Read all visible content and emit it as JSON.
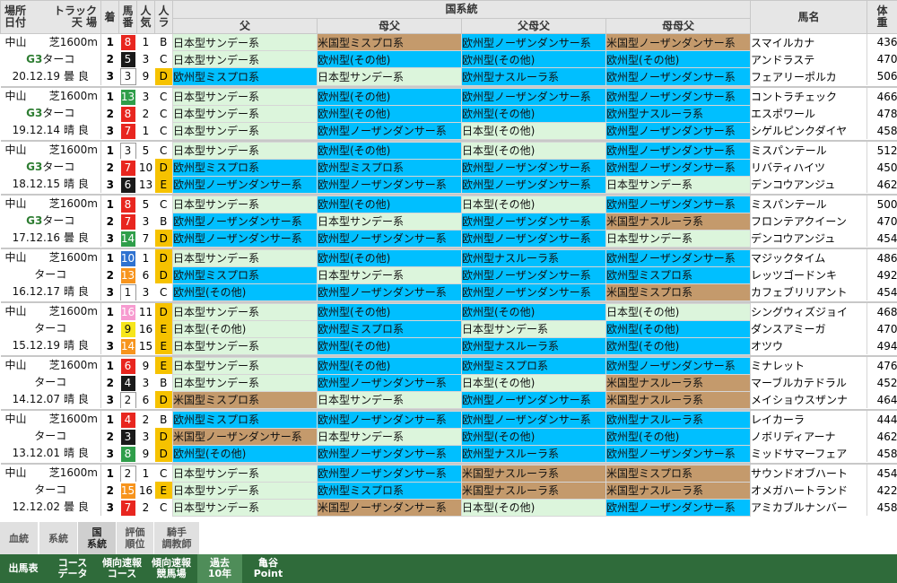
{
  "colors": {
    "jp": "#dcf5dc",
    "eu": "#00bfff",
    "us": "#c49a6c",
    "gate": [
      "#ffffff",
      "#1a1a1a",
      "#e8261f",
      "#2f72d0",
      "#f6e61b",
      "#2f9e4a",
      "#f7941d",
      "#f79bd0"
    ],
    "style": {
      "B": "#ffffff",
      "C": "#ffffff",
      "D": "#f6c200",
      "E": "#f6c200"
    }
  },
  "header": {
    "place": "場所",
    "date": "日付",
    "track": "トラック",
    "track2": "天 場",
    "finish": "着",
    "num": "馬番",
    "pop": "人気",
    "style": "人ラ",
    "country_lineage": "国系統",
    "sire": "父",
    "damsire": "母父",
    "sire_dam": "父母父",
    "dam_dam_sire": "母母父",
    "horse": "馬名",
    "weight": "体重"
  },
  "races": [
    {
      "venue": "中山",
      "course": "芝1600m",
      "grade": "G3",
      "cond": "ターコ",
      "date": "20.12.19",
      "weather": "曇 良",
      "rows": [
        {
          "fin": "1",
          "gate": "3",
          "num": "8",
          "pop": "1",
          "style": "B",
          "lin": [
            [
              "jp",
              "日本型サンデー系"
            ],
            [
              "us",
              "米国型ミスプロ系"
            ],
            [
              "eu",
              "欧州型ノーザンダンサー系"
            ],
            [
              "us",
              "米国型ノーザンダンサー系"
            ]
          ],
          "horse": "スマイルカナ",
          "wt": "436"
        },
        {
          "fin": "2",
          "gate": "2",
          "num": "5",
          "pop": "3",
          "style": "C",
          "lin": [
            [
              "jp",
              "日本型サンデー系"
            ],
            [
              "eu",
              "欧州型(その他)"
            ],
            [
              "eu",
              "欧州型(その他)"
            ],
            [
              "eu",
              "欧州型(その他)"
            ]
          ],
          "horse": "アンドラステ",
          "wt": "470"
        },
        {
          "fin": "3",
          "gate": "1",
          "num": "3",
          "pop": "9",
          "style": "D",
          "lin": [
            [
              "eu",
              "欧州型ミスプロ系"
            ],
            [
              "jp",
              "日本型サンデー系"
            ],
            [
              "eu",
              "欧州型ナスルーラ系"
            ],
            [
              "eu",
              "欧州型ノーザンダンサー系"
            ]
          ],
          "horse": "フェアリーポルカ",
          "wt": "506"
        }
      ]
    },
    {
      "venue": "中山",
      "course": "芝1600m",
      "grade": "G3",
      "cond": "ターコ",
      "date": "19.12.14",
      "weather": "晴 良",
      "rows": [
        {
          "fin": "1",
          "gate": "6",
          "num": "13",
          "pop": "3",
          "style": "C",
          "lin": [
            [
              "jp",
              "日本型サンデー系"
            ],
            [
              "eu",
              "欧州型(その他)"
            ],
            [
              "eu",
              "欧州型ノーザンダンサー系"
            ],
            [
              "eu",
              "欧州型ノーザンダンサー系"
            ]
          ],
          "horse": "コントラチェック",
          "wt": "466"
        },
        {
          "fin": "2",
          "gate": "3",
          "num": "8",
          "pop": "2",
          "style": "C",
          "lin": [
            [
              "jp",
              "日本型サンデー系"
            ],
            [
              "eu",
              "欧州型(その他)"
            ],
            [
              "eu",
              "欧州型(その他)"
            ],
            [
              "eu",
              "欧州型ナスルーラ系"
            ]
          ],
          "horse": "エスポワール",
          "wt": "478"
        },
        {
          "fin": "3",
          "gate": "3",
          "num": "7",
          "pop": "1",
          "style": "C",
          "lin": [
            [
              "jp",
              "日本型サンデー系"
            ],
            [
              "eu",
              "欧州型ノーザンダンサー系"
            ],
            [
              "jp",
              "日本型(その他)"
            ],
            [
              "eu",
              "欧州型ノーザンダンサー系"
            ]
          ],
          "horse": "シゲルピンクダイヤ",
          "wt": "458"
        }
      ]
    },
    {
      "venue": "中山",
      "course": "芝1600m",
      "grade": "G3",
      "cond": "ターコ",
      "date": "18.12.15",
      "weather": "晴 良",
      "rows": [
        {
          "fin": "1",
          "gate": "1",
          "num": "3",
          "pop": "5",
          "style": "C",
          "lin": [
            [
              "jp",
              "日本型サンデー系"
            ],
            [
              "eu",
              "欧州型(その他)"
            ],
            [
              "jp",
              "日本型(その他)"
            ],
            [
              "eu",
              "欧州型ノーザンダンサー系"
            ]
          ],
          "horse": "ミスパンテール",
          "wt": "512"
        },
        {
          "fin": "2",
          "gate": "3",
          "num": "7",
          "pop": "10",
          "style": "D",
          "lin": [
            [
              "eu",
              "欧州型ミスプロ系"
            ],
            [
              "eu",
              "欧州型ミスプロ系"
            ],
            [
              "eu",
              "欧州型ノーザンダンサー系"
            ],
            [
              "eu",
              "欧州型ノーザンダンサー系"
            ]
          ],
          "horse": "リバティハイツ",
          "wt": "450"
        },
        {
          "fin": "3",
          "gate": "2",
          "num": "6",
          "pop": "13",
          "style": "E",
          "lin": [
            [
              "eu",
              "欧州型ノーザンダンサー系"
            ],
            [
              "eu",
              "欧州型ノーザンダンサー系"
            ],
            [
              "eu",
              "欧州型ノーザンダンサー系"
            ],
            [
              "jp",
              "日本型サンデー系"
            ]
          ],
          "horse": "デンコウアンジュ",
          "wt": "462"
        }
      ]
    },
    {
      "venue": "中山",
      "course": "芝1600m",
      "grade": "G3",
      "cond": "ターコ",
      "date": "17.12.16",
      "weather": "曇 良",
      "rows": [
        {
          "fin": "1",
          "gate": "3",
          "num": "8",
          "pop": "5",
          "style": "C",
          "lin": [
            [
              "jp",
              "日本型サンデー系"
            ],
            [
              "eu",
              "欧州型(その他)"
            ],
            [
              "jp",
              "日本型(その他)"
            ],
            [
              "eu",
              "欧州型ノーザンダンサー系"
            ]
          ],
          "horse": "ミスパンテール",
          "wt": "500"
        },
        {
          "fin": "2",
          "gate": "3",
          "num": "7",
          "pop": "3",
          "style": "B",
          "lin": [
            [
              "eu",
              "欧州型ノーザンダンサー系"
            ],
            [
              "jp",
              "日本型サンデー系"
            ],
            [
              "eu",
              "欧州型ノーザンダンサー系"
            ],
            [
              "us",
              "米国型ナスルーラ系"
            ]
          ],
          "horse": "フロンテアクイーン",
          "wt": "470"
        },
        {
          "fin": "3",
          "gate": "6",
          "num": "14",
          "pop": "7",
          "style": "D",
          "lin": [
            [
              "eu",
              "欧州型ノーザンダンサー系"
            ],
            [
              "eu",
              "欧州型ノーザンダンサー系"
            ],
            [
              "eu",
              "欧州型ノーザンダンサー系"
            ],
            [
              "jp",
              "日本型サンデー系"
            ]
          ],
          "horse": "デンコウアンジュ",
          "wt": "454"
        }
      ]
    },
    {
      "venue": "中山",
      "course": "芝1600m",
      "grade": "",
      "cond": "ターコ",
      "date": "16.12.17",
      "weather": "晴 良",
      "rows": [
        {
          "fin": "1",
          "gate": "4",
          "num": "10",
          "pop": "1",
          "style": "D",
          "lin": [
            [
              "jp",
              "日本型サンデー系"
            ],
            [
              "eu",
              "欧州型(その他)"
            ],
            [
              "eu",
              "欧州型ナスルーラ系"
            ],
            [
              "eu",
              "欧州型ノーザンダンサー系"
            ]
          ],
          "horse": "マジックタイム",
          "wt": "486"
        },
        {
          "fin": "2",
          "gate": "7",
          "num": "13",
          "pop": "6",
          "style": "D",
          "lin": [
            [
              "eu",
              "欧州型ミスプロ系"
            ],
            [
              "jp",
              "日本型サンデー系"
            ],
            [
              "eu",
              "欧州型ノーザンダンサー系"
            ],
            [
              "eu",
              "欧州型ミスプロ系"
            ]
          ],
          "horse": "レッツゴードンキ",
          "wt": "492"
        },
        {
          "fin": "3",
          "gate": "1",
          "num": "1",
          "pop": "3",
          "style": "C",
          "lin": [
            [
              "eu",
              "欧州型(その他)"
            ],
            [
              "eu",
              "欧州型ノーザンダンサー系"
            ],
            [
              "eu",
              "欧州型ノーザンダンサー系"
            ],
            [
              "us",
              "米国型ミスプロ系"
            ]
          ],
          "horse": "カフェブリリアント",
          "wt": "454"
        }
      ]
    },
    {
      "venue": "中山",
      "course": "芝1600m",
      "grade": "",
      "cond": "ターコ",
      "date": "15.12.19",
      "weather": "晴 良",
      "rows": [
        {
          "fin": "1",
          "gate": "8",
          "num": "16",
          "pop": "11",
          "style": "D",
          "lin": [
            [
              "jp",
              "日本型サンデー系"
            ],
            [
              "eu",
              "欧州型(その他)"
            ],
            [
              "eu",
              "欧州型(その他)"
            ],
            [
              "jp",
              "日本型(その他)"
            ]
          ],
          "horse": "シングウィズジョイ",
          "wt": "468"
        },
        {
          "fin": "2",
          "gate": "5",
          "num": "9",
          "pop": "16",
          "style": "E",
          "lin": [
            [
              "jp",
              "日本型(その他)"
            ],
            [
              "eu",
              "欧州型ミスプロ系"
            ],
            [
              "jp",
              "日本型サンデー系"
            ],
            [
              "eu",
              "欧州型(その他)"
            ]
          ],
          "horse": "ダンスアミーガ",
          "wt": "470"
        },
        {
          "fin": "3",
          "gate": "7",
          "num": "14",
          "pop": "15",
          "style": "E",
          "lin": [
            [
              "jp",
              "日本型サンデー系"
            ],
            [
              "eu",
              "欧州型(その他)"
            ],
            [
              "eu",
              "欧州型ナスルーラ系"
            ],
            [
              "eu",
              "欧州型(その他)"
            ]
          ],
          "horse": "オツウ",
          "wt": "494"
        }
      ]
    },
    {
      "venue": "中山",
      "course": "芝1600m",
      "grade": "",
      "cond": "ターコ",
      "date": "14.12.07",
      "weather": "晴 良",
      "rows": [
        {
          "fin": "1",
          "gate": "3",
          "num": "6",
          "pop": "9",
          "style": "E",
          "lin": [
            [
              "jp",
              "日本型サンデー系"
            ],
            [
              "eu",
              "欧州型(その他)"
            ],
            [
              "eu",
              "欧州型ミスプロ系"
            ],
            [
              "eu",
              "欧州型ノーザンダンサー系"
            ]
          ],
          "horse": "ミナレット",
          "wt": "476"
        },
        {
          "fin": "2",
          "gate": "2",
          "num": "4",
          "pop": "3",
          "style": "B",
          "lin": [
            [
              "jp",
              "日本型サンデー系"
            ],
            [
              "eu",
              "欧州型ノーザンダンサー系"
            ],
            [
              "jp",
              "日本型(その他)"
            ],
            [
              "us",
              "米国型ナスルーラ系"
            ]
          ],
          "horse": "マーブルカテドラル",
          "wt": "452"
        },
        {
          "fin": "3",
          "gate": "1",
          "num": "2",
          "pop": "6",
          "style": "D",
          "lin": [
            [
              "us",
              "米国型ミスプロ系"
            ],
            [
              "jp",
              "日本型サンデー系"
            ],
            [
              "eu",
              "欧州型ノーザンダンサー系"
            ],
            [
              "us",
              "米国型ナスルーラ系"
            ]
          ],
          "horse": "メイショウスザンナ",
          "wt": "464"
        }
      ]
    },
    {
      "venue": "中山",
      "course": "芝1600m",
      "grade": "",
      "cond": "ターコ",
      "date": "13.12.01",
      "weather": "晴 良",
      "rows": [
        {
          "fin": "1",
          "gate": "3",
          "num": "4",
          "pop": "2",
          "style": "B",
          "lin": [
            [
              "eu",
              "欧州型ミスプロ系"
            ],
            [
              "eu",
              "欧州型ノーザンダンサー系"
            ],
            [
              "eu",
              "欧州型ノーザンダンサー系"
            ],
            [
              "eu",
              "欧州型ナスルーラ系"
            ]
          ],
          "horse": "レイカーラ",
          "wt": "444"
        },
        {
          "fin": "2",
          "gate": "2",
          "num": "3",
          "pop": "3",
          "style": "D",
          "lin": [
            [
              "us",
              "米国型ノーザンダンサー系"
            ],
            [
              "jp",
              "日本型サンデー系"
            ],
            [
              "eu",
              "欧州型(その他)"
            ],
            [
              "eu",
              "欧州型(その他)"
            ]
          ],
          "horse": "ノボリディアーナ",
          "wt": "462"
        },
        {
          "fin": "3",
          "gate": "6",
          "num": "8",
          "pop": "9",
          "style": "D",
          "lin": [
            [
              "eu",
              "欧州型(その他)"
            ],
            [
              "eu",
              "欧州型ノーザンダンサー系"
            ],
            [
              "eu",
              "欧州型ナスルーラ系"
            ],
            [
              "eu",
              "欧州型ノーザンダンサー系"
            ]
          ],
          "horse": "ミッドサマーフェア",
          "wt": "458"
        }
      ]
    },
    {
      "venue": "中山",
      "course": "芝1600m",
      "grade": "",
      "cond": "ターコ",
      "date": "12.12.02",
      "weather": "曇 良",
      "rows": [
        {
          "fin": "1",
          "gate": "1",
          "num": "2",
          "pop": "1",
          "style": "C",
          "lin": [
            [
              "jp",
              "日本型サンデー系"
            ],
            [
              "eu",
              "欧州型ノーザンダンサー系"
            ],
            [
              "us",
              "米国型ナスルーラ系"
            ],
            [
              "us",
              "米国型ミスプロ系"
            ]
          ],
          "horse": "サウンドオブハート",
          "wt": "454"
        },
        {
          "fin": "2",
          "gate": "7",
          "num": "15",
          "pop": "16",
          "style": "E",
          "lin": [
            [
              "jp",
              "日本型サンデー系"
            ],
            [
              "eu",
              "欧州型ミスプロ系"
            ],
            [
              "us",
              "米国型ナスルーラ系"
            ],
            [
              "us",
              "米国型ナスルーラ系"
            ]
          ],
          "horse": "オメガハートランド",
          "wt": "422"
        },
        {
          "fin": "3",
          "gate": "3",
          "num": "7",
          "pop": "2",
          "style": "C",
          "lin": [
            [
              "jp",
              "日本型サンデー系"
            ],
            [
              "us",
              "米国型ノーザンダンサー系"
            ],
            [
              "jp",
              "日本型(その他)"
            ],
            [
              "eu",
              "欧州型ノーザンダンサー系"
            ]
          ],
          "horse": "アミカブルナンバー",
          "wt": "458"
        }
      ]
    }
  ],
  "tabs": [
    {
      "l1": "血統",
      "l2": "",
      "active": false
    },
    {
      "l1": "系統",
      "l2": "",
      "active": false
    },
    {
      "l1": "国",
      "l2": "系統",
      "active": true
    },
    {
      "l1": "評価",
      "l2": "順位",
      "active": false
    },
    {
      "l1": "騎手",
      "l2": "調教師",
      "active": false
    }
  ],
  "nav": [
    {
      "l1": "出馬表",
      "l2": "",
      "active": false
    },
    {
      "l1": "コース",
      "l2": "データ",
      "active": false
    },
    {
      "l1": "傾向速報",
      "l2": "コース",
      "active": false
    },
    {
      "l1": "傾向速報",
      "l2": "競馬場",
      "active": false
    },
    {
      "l1": "過去",
      "l2": "10年",
      "active": true
    },
    {
      "l1": "亀谷",
      "l2": "Point",
      "active": false
    }
  ]
}
